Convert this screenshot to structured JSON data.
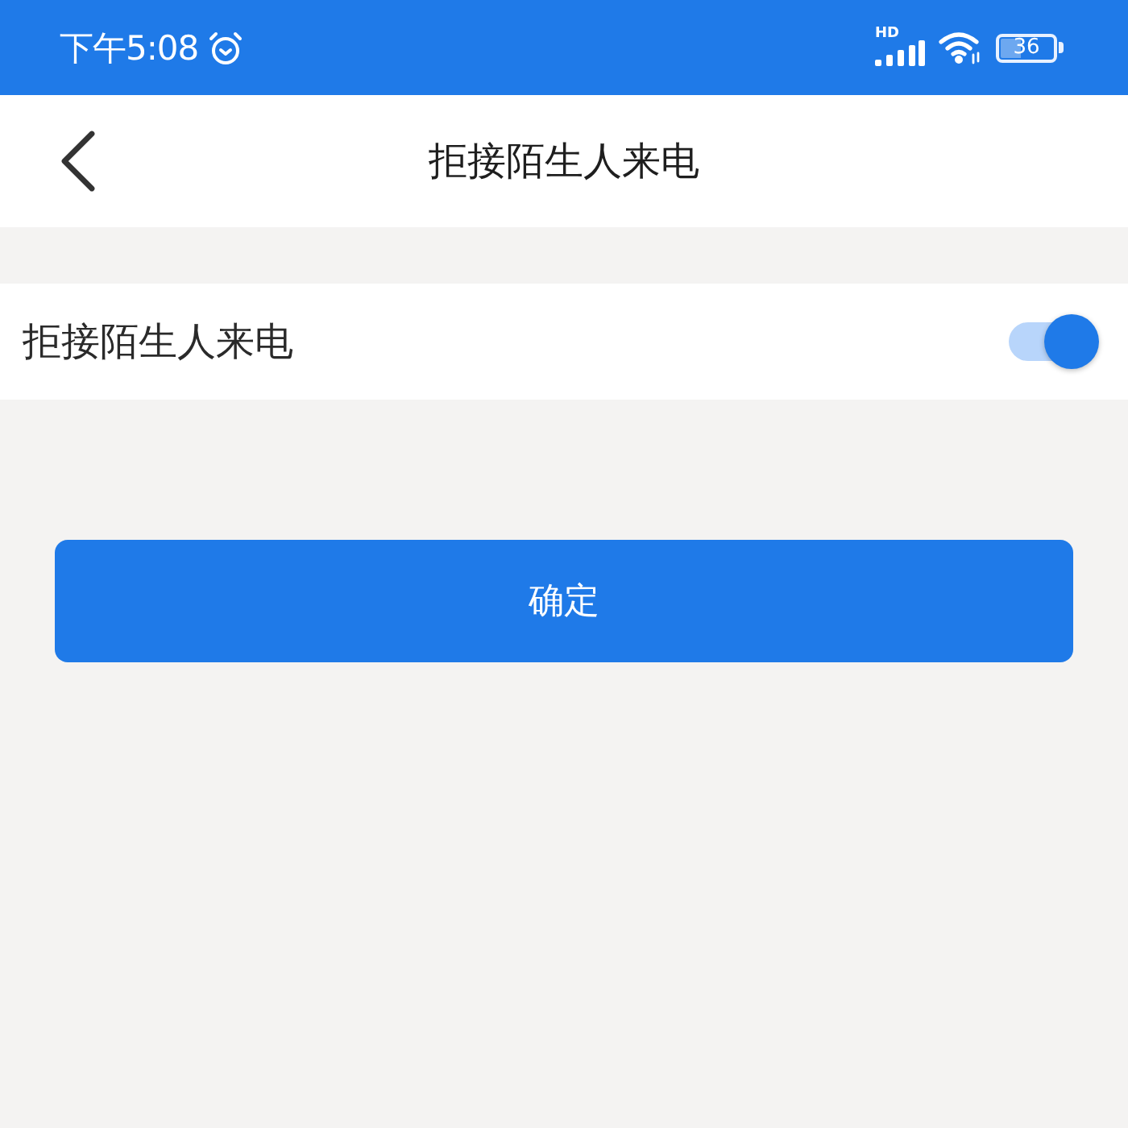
{
  "status_bar": {
    "time": "下午5:08",
    "network_label": "HD",
    "battery": "36"
  },
  "header": {
    "title": "拒接陌生人来电"
  },
  "settings": [
    {
      "kind": "toggle",
      "label": "拒接陌生人来电",
      "on": true
    }
  ],
  "confirm_button": {
    "label": "确定"
  }
}
